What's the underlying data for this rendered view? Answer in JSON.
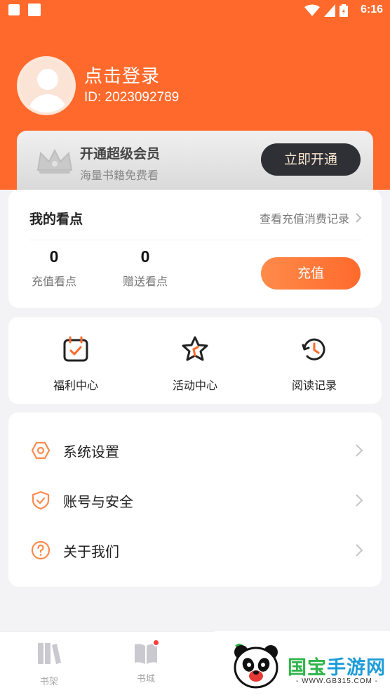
{
  "status_bar": {
    "time": "6:16"
  },
  "profile": {
    "login_text": "点击登录",
    "user_id": "ID: 2023092789"
  },
  "vip": {
    "title": "开通超级会员",
    "subtitle": "海量书籍免费看",
    "button": "立即开通"
  },
  "points": {
    "title": "我的看点",
    "records_link": "查看充值消费记录",
    "recharged": {
      "value": "0",
      "label": "充值看点"
    },
    "gifted": {
      "value": "0",
      "label": "赠送看点"
    },
    "recharge_button": "充值"
  },
  "quick_actions": [
    {
      "label": "福利中心",
      "icon": "calendar-check-icon"
    },
    {
      "label": "活动中心",
      "icon": "star-icon"
    },
    {
      "label": "阅读记录",
      "icon": "history-clock-icon"
    }
  ],
  "settings": [
    {
      "label": "系统设置",
      "icon": "hexagon-settings-icon"
    },
    {
      "label": "账号与安全",
      "icon": "shield-check-icon"
    },
    {
      "label": "关于我们",
      "icon": "question-circle-icon"
    }
  ],
  "tabbar": [
    {
      "label": "书架",
      "icon": "bookshelf-icon"
    },
    {
      "label": "书城",
      "icon": "book-open-icon",
      "badge": true
    }
  ],
  "watermark": {
    "name_part1": "国宝",
    "name_part2": "手游网",
    "url": "- WWW.GB315.COM -"
  },
  "colors": {
    "accent": "#ff6a2c",
    "vip_button": "#2f3036",
    "tab_inactive": "#aaaaaa"
  }
}
